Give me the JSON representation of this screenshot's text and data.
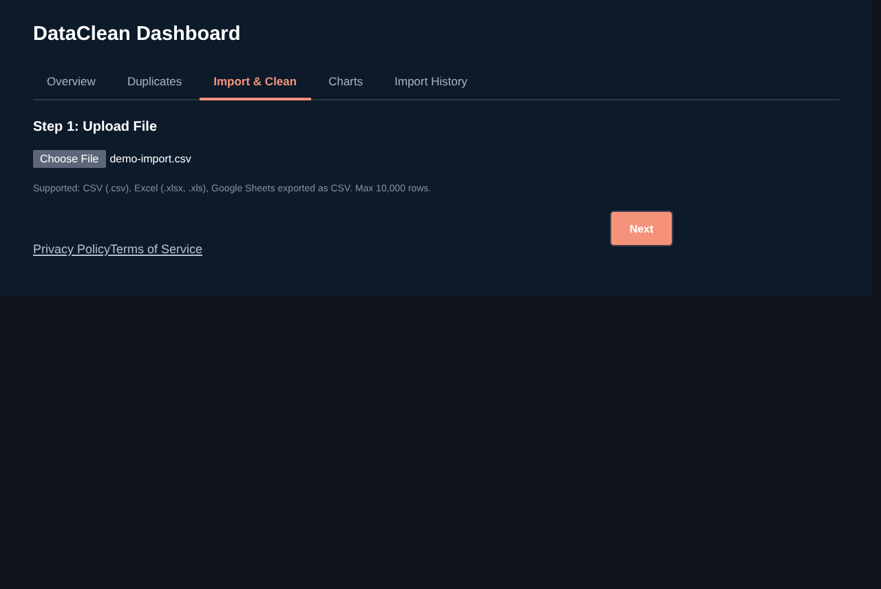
{
  "title": "DataClean Dashboard",
  "tabs": [
    {
      "label": "Overview",
      "selected": false
    },
    {
      "label": "Duplicates",
      "selected": false
    },
    {
      "label": "Import & Clean",
      "selected": true
    },
    {
      "label": "Charts",
      "selected": false
    },
    {
      "label": "Import History",
      "selected": false
    }
  ],
  "step": {
    "heading": "Step 1: Upload File",
    "choose_button": "Choose File",
    "file_name": "demo-import.csv",
    "hint": "Supported: CSV (.csv), Excel (.xlsx, .xls), Google Sheets exported as CSV. Max 10,000 rows."
  },
  "next_button": "Next",
  "footer_links": [
    "Privacy Policy",
    "Terms of Service"
  ]
}
